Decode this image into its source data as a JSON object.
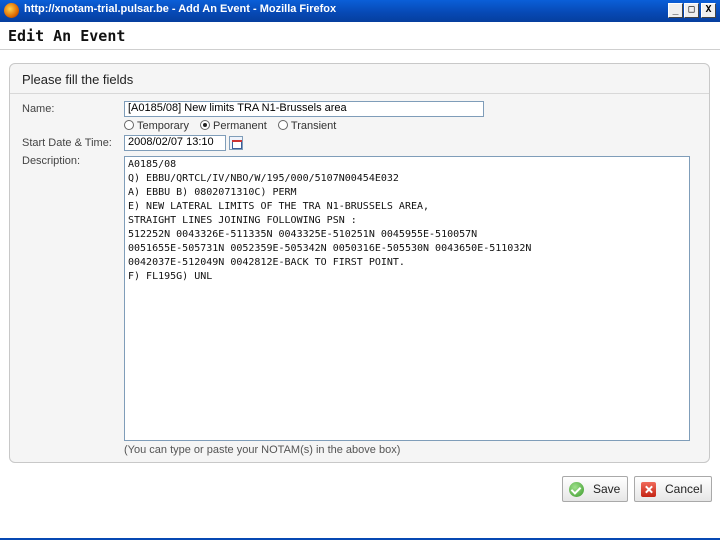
{
  "window": {
    "title": "http://xnotam-trial.pulsar.be - Add An Event - Mozilla Firefox",
    "minimize": "_",
    "maximize": "□",
    "close": "X"
  },
  "page": {
    "title": "Edit An Event"
  },
  "form": {
    "heading": "Please fill the fields",
    "name_label": "Name:",
    "name_value": "[A0185/08] New limits TRA N1-Brussels area",
    "type_options": [
      "Temporary",
      "Permanent",
      "Transient"
    ],
    "type_selected": "Permanent",
    "start_label": "Start Date & Time:",
    "start_value": "2008/02/07 13:10",
    "description_label": "Description:",
    "description_value": "A0185/08\nQ) EBBU/QRTCL/IV/NBO/W/195/000/5107N00454E032\nA) EBBU B) 0802071310C) PERM\nE) NEW LATERAL LIMITS OF THE TRA N1-BRUSSELS AREA,\nSTRAIGHT LINES JOINING FOLLOWING PSN :\n512252N 0043326E-511335N 0043325E-510251N 0045955E-510057N\n0051655E-505731N 0052359E-505342N 0050316E-505530N 0043650E-511032N\n0042037E-512049N 0042812E-BACK TO FIRST POINT.\nF) FL195G) UNL",
    "hint": "(You can type or paste your NOTAM(s) in the above box)"
  },
  "actions": {
    "save_label": "Save",
    "cancel_label": "Cancel"
  },
  "colors": {
    "titlebar": "#0748b3",
    "save_icon": "#3a9a2a",
    "cancel_icon": "#c42414"
  }
}
